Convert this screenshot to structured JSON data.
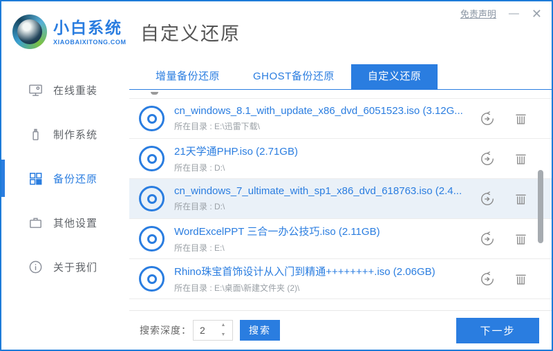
{
  "window": {
    "disclaimer_link": "免责声明",
    "minimize_icon": "—",
    "close_icon": "✕"
  },
  "header": {
    "logo_title": "小白系统",
    "logo_subtitle": "XIAOBAIXITONG.COM",
    "page_title": "自定义还原"
  },
  "sidebar": {
    "items": [
      {
        "label": "在线重装",
        "icon": "monitor-icon",
        "active": false
      },
      {
        "label": "制作系统",
        "icon": "usb-drive-icon",
        "active": false
      },
      {
        "label": "备份还原",
        "icon": "grid-icon",
        "active": true
      },
      {
        "label": "其他设置",
        "icon": "briefcase-icon",
        "active": false
      },
      {
        "label": "关于我们",
        "icon": "info-icon",
        "active": false
      }
    ]
  },
  "tabs": [
    {
      "label": "增量备份还原",
      "active": false
    },
    {
      "label": "GHOST备份还原",
      "active": false
    },
    {
      "label": "自定义还原",
      "active": true
    }
  ],
  "list": {
    "action_icons": [
      "restore-icon",
      "trash-icon"
    ],
    "items": [
      {
        "title": "cn_windows_8.1_with_update_x86_dvd_6051523.iso (3.12G...",
        "subtitle": "所在目录 : E:\\迅雷下载\\",
        "highlighted": false
      },
      {
        "title": "21天学通PHP.iso (2.71GB)",
        "subtitle": "所在目录 : D:\\",
        "highlighted": false
      },
      {
        "title": "cn_windows_7_ultimate_with_sp1_x86_dvd_618763.iso (2.4...",
        "subtitle": "所在目录 : D:\\",
        "highlighted": true
      },
      {
        "title": "WordExcelPPT 三合一办公技巧.iso (2.11GB)",
        "subtitle": "所在目录 : E:\\",
        "highlighted": false
      },
      {
        "title": "Rhino珠宝首饰设计从入门到精通++++++++.iso (2.06GB)",
        "subtitle": "所在目录 : E:\\桌面\\新建文件夹 (2)\\",
        "highlighted": false
      }
    ]
  },
  "footer": {
    "search_depth_label": "搜索深度：",
    "search_depth_value": "2",
    "search_button": "搜索",
    "next_button": "下一步"
  },
  "colors": {
    "primary": "#2a7de0",
    "window_border": "#1d7bd9",
    "row_highlight": "#eaf1f8"
  }
}
